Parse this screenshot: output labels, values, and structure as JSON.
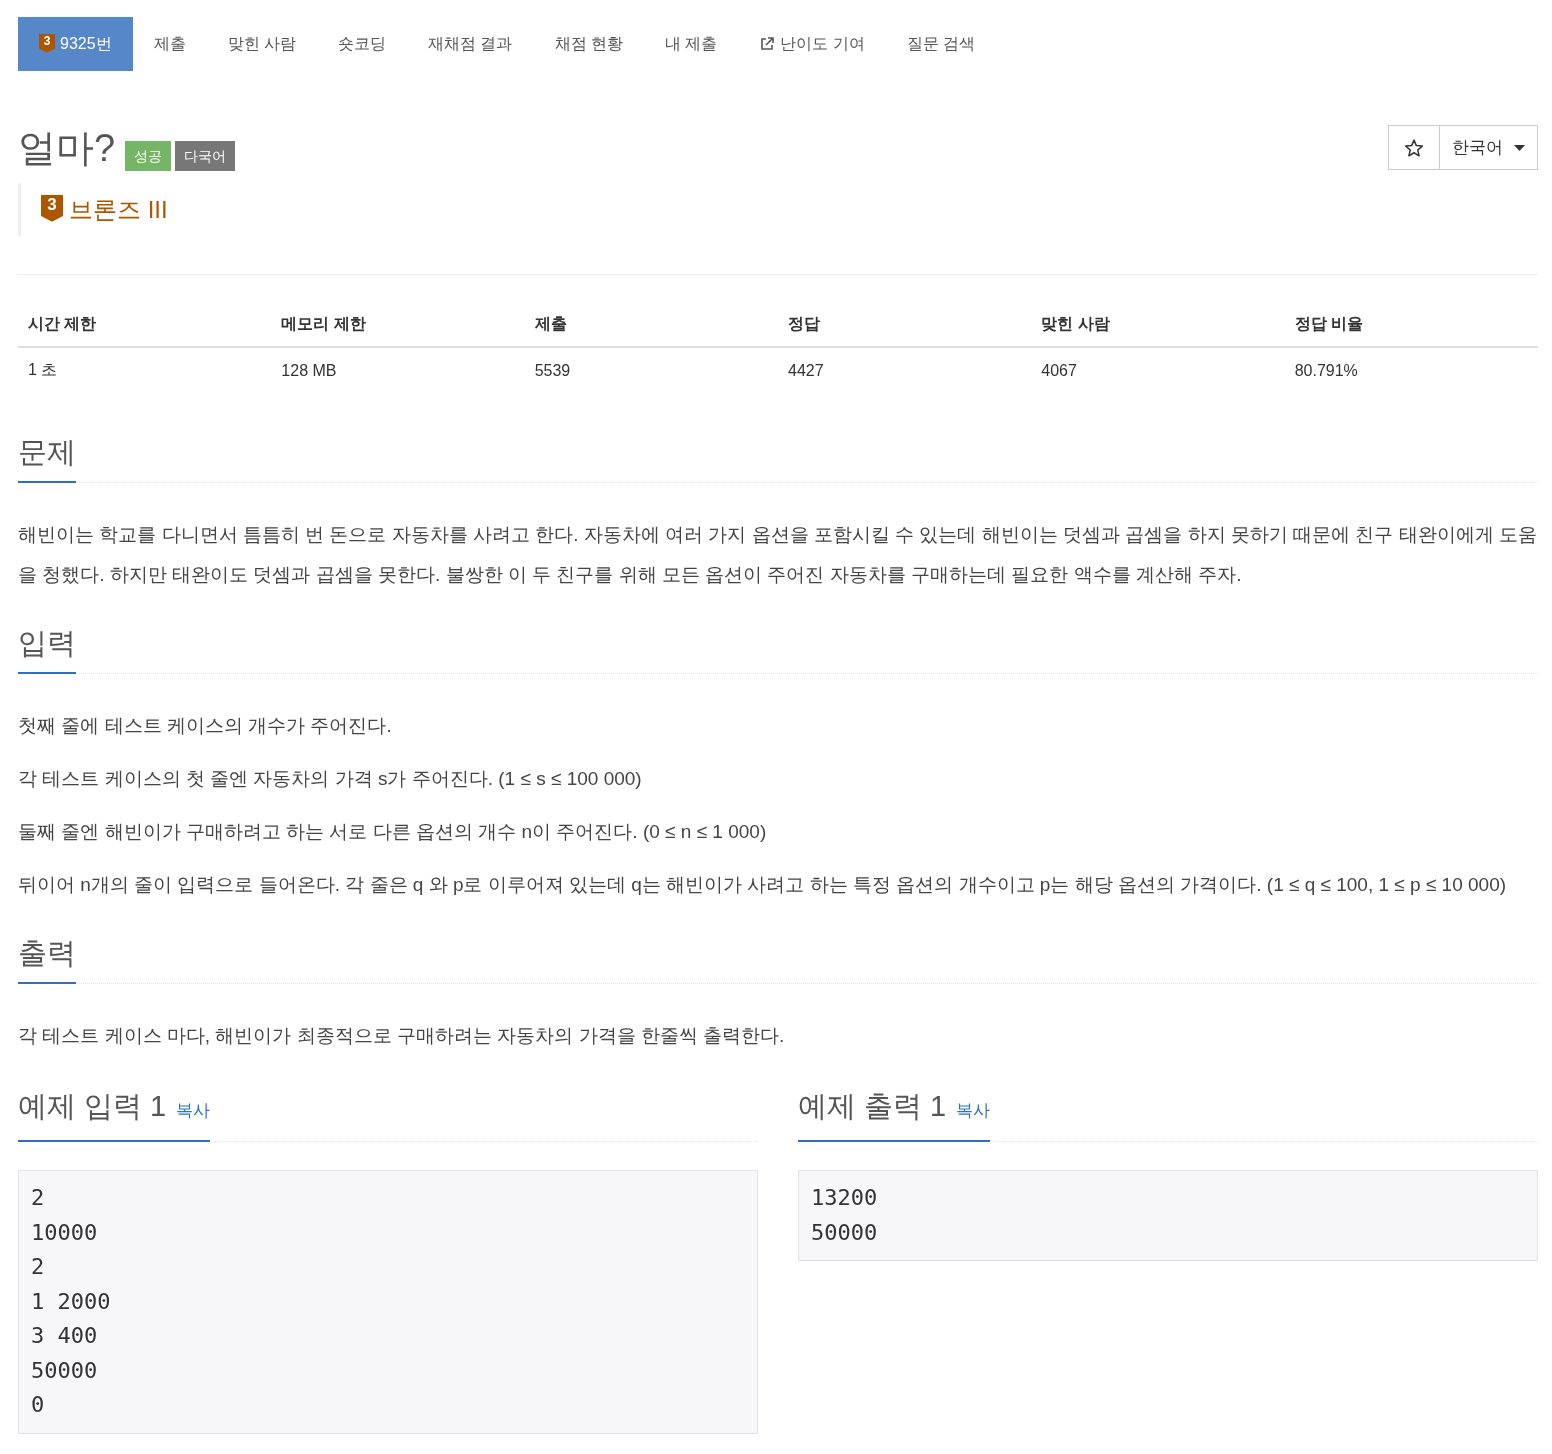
{
  "nav": {
    "tabs": [
      {
        "kind": "problem",
        "badge": "3",
        "label": "9325번",
        "selected": true
      },
      {
        "kind": "plain",
        "label": "제출",
        "selected": false
      },
      {
        "kind": "plain",
        "label": "맞힌 사람",
        "selected": false
      },
      {
        "kind": "plain",
        "label": "숏코딩",
        "selected": false
      },
      {
        "kind": "plain",
        "label": "재채점 결과",
        "selected": false
      },
      {
        "kind": "plain",
        "label": "채점 현황",
        "selected": false
      },
      {
        "kind": "plain",
        "label": "내 제출",
        "selected": false
      },
      {
        "kind": "external",
        "label": "난이도 기여",
        "selected": false
      },
      {
        "kind": "plain",
        "label": "질문 검색",
        "selected": false
      }
    ]
  },
  "problem": {
    "title": "얼마?",
    "labels": [
      {
        "text": "성공",
        "color": "#74b566"
      },
      {
        "text": "다국어",
        "color": "#777777"
      }
    ],
    "tier": {
      "badge": "3",
      "name": "브론즈 III"
    }
  },
  "toolbar": {
    "language": "한국어"
  },
  "limits_table": {
    "columns": [
      "시간 제한",
      "메모리 제한",
      "제출",
      "정답",
      "맞힌 사람",
      "정답 비율"
    ],
    "rows": [
      [
        "1 초",
        "128 MB",
        "5539",
        "4427",
        "4067",
        "80.791%"
      ]
    ]
  },
  "sections": [
    {
      "heading": "문제",
      "paragraphs": [
        "해빈이는 학교를 다니면서 틈틈히 번 돈으로 자동차를 사려고 한다. 자동차에 여러 가지 옵션을 포함시킬 수 있는데 해빈이는 덧셈과 곱셈을 하지 못하기 때문에 친구 태완이에게 도움을 청했다. 하지만 태완이도 덧셈과 곱셈을 못한다. 불쌍한 이 두 친구를 위해 모든 옵션이 주어진 자동차를 구매하는데 필요한 액수를 계산해 주자."
      ]
    },
    {
      "heading": "입력",
      "paragraphs": [
        "첫째 줄에 테스트 케이스의 개수가 주어진다.",
        "각 테스트 케이스의 첫 줄엔 자동차의 가격 s가 주어진다. (1 ≤ s ≤ 100 000)",
        "둘째 줄엔 해빈이가 구매하려고 하는 서로 다른 옵션의 개수 n이 주어진다. (0 ≤ n ≤ 1 000)",
        "뒤이어 n개의 줄이 입력으로 들어온다. 각 줄은 q 와 p로 이루어져 있는데 q는 해빈이가 사려고 하는 특정 옵션의 개수이고 p는 해당 옵션의 가격이다. (1 ≤ q ≤ 100, 1 ≤ p ≤ 10 000)"
      ]
    },
    {
      "heading": "출력",
      "paragraphs": [
        "각 테스트 케이스 마다, 해빈이가 최종적으로 구매하려는 자동차의 가격을 한줄씩 출력한다."
      ]
    }
  ],
  "samples": [
    {
      "heading": "예제 입력 1",
      "copy": "복사",
      "lines": [
        "2",
        "10000",
        "2",
        "1 2000",
        "3 400",
        "50000",
        "0"
      ]
    },
    {
      "heading": "예제 출력 1",
      "copy": "복사",
      "lines": [
        "13200",
        "50000"
      ]
    }
  ]
}
